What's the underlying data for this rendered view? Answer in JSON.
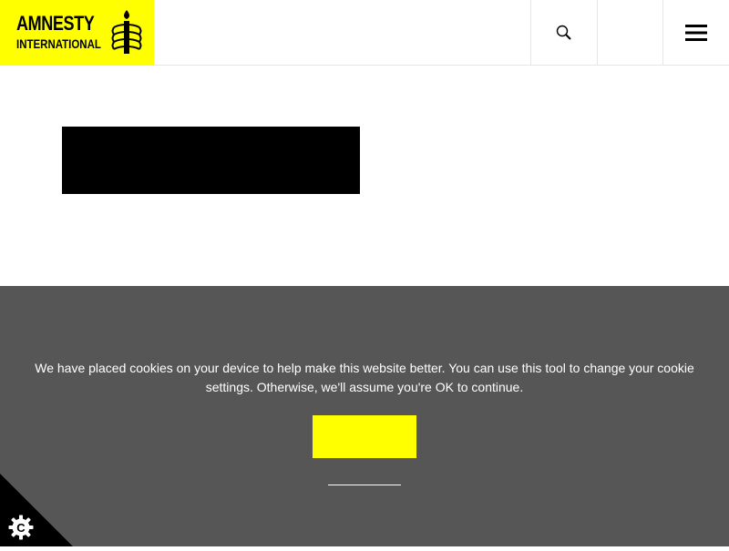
{
  "header": {
    "logo": {
      "line1": "AMNESTY",
      "line2": "INTERNATIONAL",
      "icon": "candle-barbed-wire-icon"
    },
    "search_icon": "search-icon",
    "language_label": "",
    "menu_icon": "hamburger-menu-icon"
  },
  "main": {
    "block_text": ""
  },
  "cookie_banner": {
    "message": "We have placed cookies on your device to help make this website better. You can use this tool to change your cookie settings. Otherwise, we'll assume you're OK to continue.",
    "ok_label": "",
    "settings_link_label": "",
    "corner_icon": "cookie-settings-gear-icon",
    "colors": {
      "background": "#565656",
      "button": "#ffff00",
      "text": "#ffffff"
    }
  },
  "colors": {
    "brand_yellow": "#ffff00",
    "black": "#000000"
  }
}
